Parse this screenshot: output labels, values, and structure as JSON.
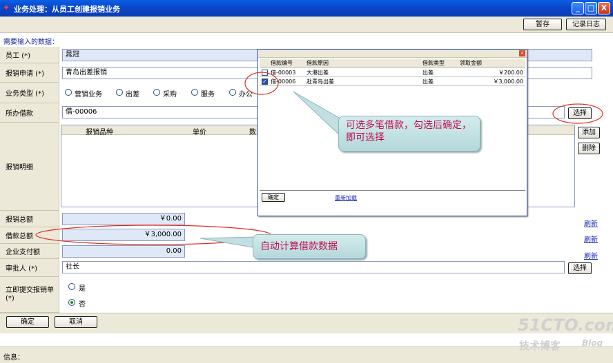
{
  "window": {
    "title": "业务处理：从员工创建报销业务",
    "min": "_",
    "max": "□",
    "close": "X"
  },
  "toolbar": {
    "draft": "暂存",
    "log": "记录日志"
  },
  "form": {
    "need_label": "需要输入的数据：",
    "employee": {
      "label": "员工 (*)",
      "value": "晁冠"
    },
    "application": {
      "label": "报销申请 (*)",
      "value": "青岛出差报销"
    },
    "biz_type": {
      "label": "业务类型 (*)",
      "options": [
        "营销业务",
        "出差",
        "采购",
        "服务",
        "办公"
      ],
      "selected": null
    },
    "loan": {
      "label": "所办借款",
      "value": "借-00006",
      "select": "选择"
    },
    "detail": {
      "label": "报销明细",
      "columns": [
        "报销品种",
        "单价",
        "数"
      ],
      "add": "添加",
      "delete": "删除"
    },
    "total": {
      "label": "报销总额",
      "value": "￥0.00",
      "refresh": "刷新"
    },
    "loan_total": {
      "label": "借款总额",
      "value": "￥3,000.00",
      "refresh": "刷新"
    },
    "company_pay": {
      "label": "企业支付额",
      "value": "0.00",
      "refresh": "刷新"
    },
    "approver": {
      "label": "审批人 (*)",
      "value": "社长",
      "select": "选择"
    },
    "submit": {
      "label": "立即提交报销单 (*)",
      "yes": "是",
      "no": "否",
      "selected": "no"
    },
    "ok": "确定",
    "cancel": "取消"
  },
  "status": {
    "label": "信息："
  },
  "popup": {
    "columns": [
      "借款编号",
      "借款原因",
      "借款类型",
      "领取金额"
    ],
    "rows": [
      {
        "checked": false,
        "id": "借-00003",
        "reason": "大港出差",
        "type": "出差",
        "amount": "￥200.00"
      },
      {
        "checked": true,
        "id": "借-00006",
        "reason": "赴青岛出差",
        "type": "出差",
        "amount": "￥3,000.00"
      }
    ],
    "ok": "确定",
    "reload": "重新加载"
  },
  "callouts": {
    "multi": "可选多笔借款，勾选后确定，即可选择",
    "auto": "自动计算借款数据"
  },
  "watermark": {
    "site": "51CTO.com",
    "sub": "技术博客",
    "blog": "Blog"
  },
  "colors": {
    "title_bar": "#0a46c8",
    "annotation_ellipse": "#e03020",
    "callout_text": "#c01050"
  }
}
